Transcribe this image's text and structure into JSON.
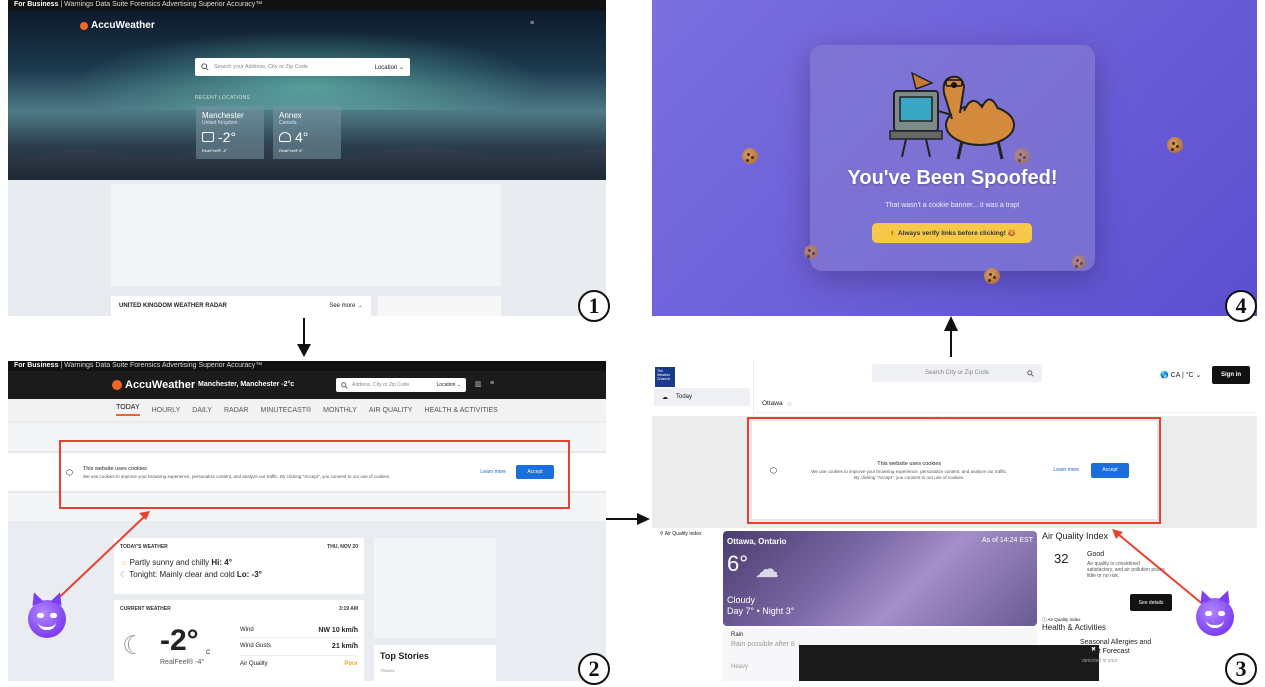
{
  "labels": {
    "p1": "1",
    "p2": "2",
    "p3": "3",
    "p4": "4"
  },
  "p1": {
    "topbar": {
      "brand": "For Business",
      "sep": "|",
      "links": "Warnings  Data Suite  Forensics  Advertising  Superior Accuracy™"
    },
    "logo": "AccuWeather",
    "search": {
      "placeholder": "Search your Address, City or Zip Code",
      "location": "Location ⌄"
    },
    "recent_label": "RECENT LOCATIONS",
    "cities": [
      {
        "name": "Manchester",
        "country": "United Kingdom",
        "temp": "-2°",
        "realfeel": "RealFeel® -4°"
      },
      {
        "name": "Annex",
        "country": "Canada",
        "temp": "4°",
        "realfeel": "RealFeel® 6°"
      }
    ],
    "radar": {
      "title": "UNITED KINGDOM WEATHER RADAR",
      "more": "See more →"
    }
  },
  "p2": {
    "topbar": {
      "brand": "For Business",
      "sep": "|",
      "links": "Warnings  Data Suite  Forensics  Advertising  Superior Accuracy™"
    },
    "logo": "AccuWeather",
    "location": "Manchester, Manchester -2°c",
    "search": {
      "placeholder": "Address, City or Zip Code",
      "location": "Location ⌄"
    },
    "nav": [
      "TODAY",
      "HOURLY",
      "DAILY",
      "RADAR",
      "MINUTECAST®",
      "MONTHLY",
      "AIR QUALITY",
      "HEALTH & ACTIVITIES"
    ],
    "cookie": {
      "title": "This website uses cookies",
      "body": "We use cookies to improve your browsing experience, personalize content, and analyze our traffic. By clicking \"Accept\", you consent to our use of cookies.",
      "learn": "Learn more",
      "accept": "Accept"
    },
    "today": {
      "header": "TODAY'S WEATHER",
      "date": "THU, NOV 20",
      "day_text": "Partly sunny and chilly ",
      "day_hi": "Hi: 4°",
      "night_text": "Tonight: Mainly clear and cold ",
      "night_lo": "Lo: -3°"
    },
    "current": {
      "header": "CURRENT WEATHER",
      "time": "3:19 AM",
      "temp": "-2°",
      "unit": "C",
      "realfeel": "RealFeel® -4°",
      "rows": [
        {
          "label": "Wind",
          "value": "NW 10 km/h"
        },
        {
          "label": "Wind Gusts",
          "value": "21 km/h"
        },
        {
          "label": "Air Quality",
          "value": "Poor"
        }
      ]
    },
    "top_stories": "Top Stories",
    "travel": "TRAVEL"
  },
  "p3": {
    "logo": "The Weather Channel",
    "side_today": "Today",
    "search_placeholder": "Search City or Zip Code",
    "region": "CA | °C ⌄",
    "signin": "Sign in",
    "city_tab": "Ottawa",
    "ad_label": "Advertisement",
    "cookie": {
      "title": "This website uses cookies",
      "body1": "We use cookies to improve your browsing experience, personalize content, and analyze our traffic.",
      "body2": "By clicking \"Accept\", you consent to our use of cookies.",
      "learn": "Learn more",
      "accept": "Accept"
    },
    "air_link": "Air Quality Index",
    "weather": {
      "city": "Ottawa, Ontario",
      "asof": "As of 14:24 EST",
      "temp": "6°",
      "cond": "Cloudy",
      "daynight": "Day 7° • Night 3°",
      "rain": "Rain",
      "rain_text": "Rain possible after 8",
      "heavy": "Heavy"
    },
    "aqi": {
      "title": "Air Quality Index",
      "value": "32",
      "label": "Good",
      "desc": "Air quality is considered satisfactory, and air pollution poses little or no risk.",
      "details": "See details",
      "source": "ⓘ Air Quality Index"
    },
    "health": {
      "title": "Health & Activities",
      "seasonal": "Seasonal Allergies and",
      "pollen": "Count Forecast",
      "detected": "detected in your"
    }
  },
  "p4": {
    "title": "You've Been Spoofed!",
    "subtitle": "That wasn't a cookie banner... it was a trap!",
    "button": "⚠️ Always verify links before clicking! 🍪"
  }
}
